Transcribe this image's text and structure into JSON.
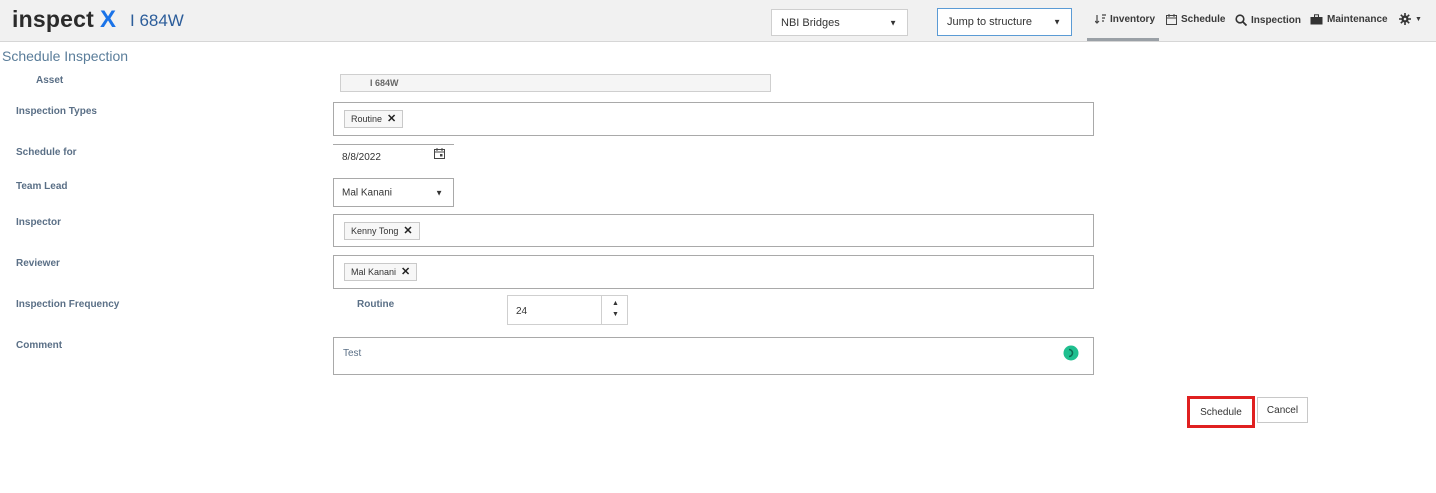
{
  "header": {
    "brand_text": "inspect",
    "brand_mark": "X",
    "asset_title": "I 684W",
    "dataset_select": "NBI Bridges",
    "jump_select": "Jump to structure",
    "nav": [
      {
        "label": "Inventory",
        "icon": "sort-icon"
      },
      {
        "label": "Schedule",
        "icon": "calendar-icon"
      },
      {
        "label": "Inspection",
        "icon": "search-icon"
      },
      {
        "label": "Maintenance",
        "icon": "briefcase-icon"
      }
    ]
  },
  "page": {
    "title": "Schedule Inspection"
  },
  "form": {
    "asset": {
      "label": "Asset",
      "value": "I 684W"
    },
    "inspection_types": {
      "label": "Inspection Types",
      "chips": [
        "Routine"
      ]
    },
    "schedule_for": {
      "label": "Schedule for",
      "value": "8/8/2022"
    },
    "team_lead": {
      "label": "Team Lead",
      "value": "Mal Kanani"
    },
    "inspector": {
      "label": "Inspector",
      "chips": [
        "Kenny Tong"
      ]
    },
    "reviewer": {
      "label": "Reviewer",
      "chips": [
        "Mal Kanani"
      ]
    },
    "frequency": {
      "label": "Inspection Frequency",
      "sublabel": "Routine",
      "value": "24"
    },
    "comment": {
      "label": "Comment",
      "value": "Test"
    }
  },
  "actions": {
    "schedule": "Schedule",
    "cancel": "Cancel"
  },
  "colors": {
    "brand_accent": "#1a73e8",
    "highlight": "#e02020",
    "status_dot": "#1fbf8f"
  }
}
